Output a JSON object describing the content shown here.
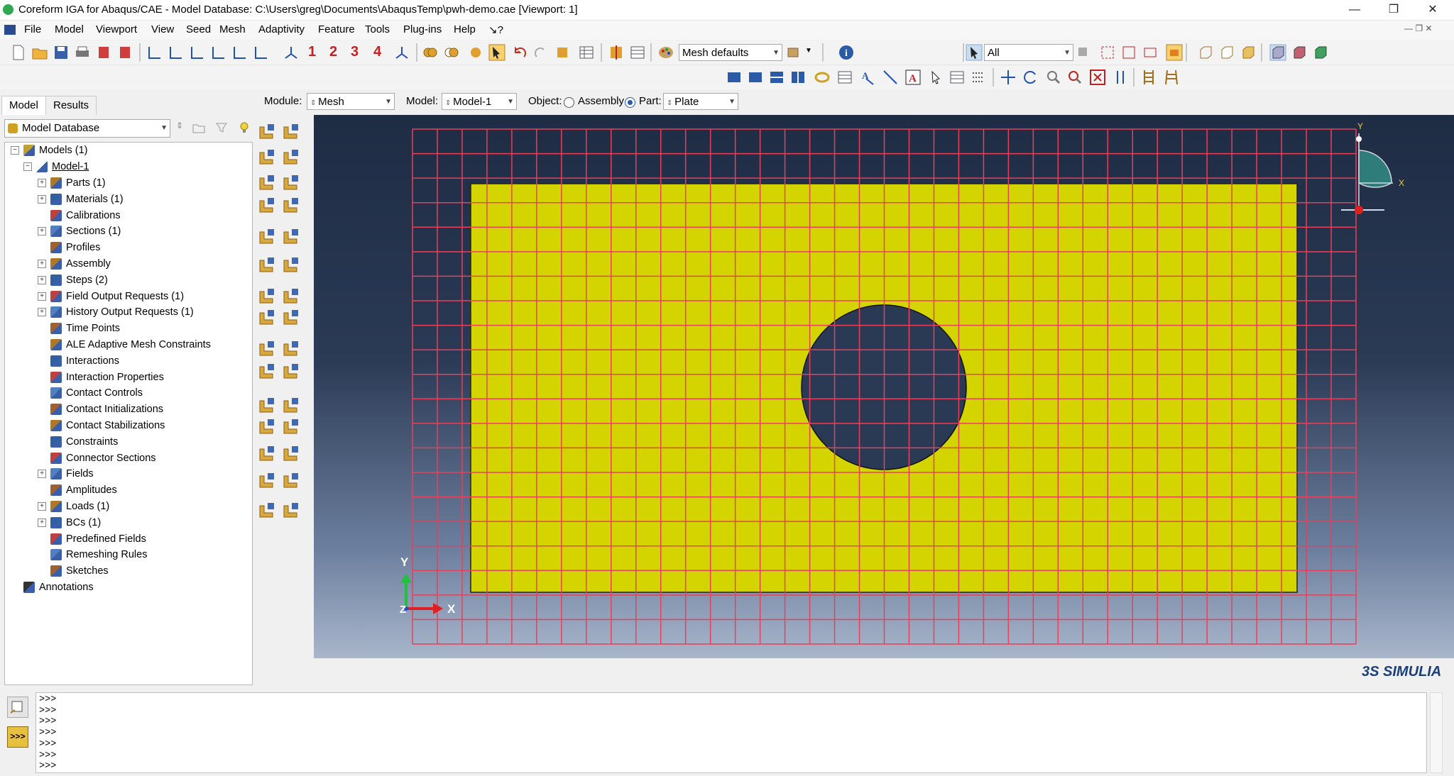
{
  "window": {
    "title": "Coreform IGA for Abaqus/CAE - Model Database: C:\\Users\\greg\\Documents\\AbaqusTemp\\pwh-demo.cae [Viewport: 1]",
    "minimize": "—",
    "restore": "❐",
    "close": "✕"
  },
  "menu": [
    "File",
    "Model",
    "Viewport",
    "View",
    "Seed",
    "Mesh",
    "Adaptivity",
    "Feature",
    "Tools",
    "Plug-ins",
    "Help",
    "↘?"
  ],
  "toolbar": {
    "view_numbers": [
      "1",
      "2",
      "3",
      "4"
    ],
    "color_code_combo": "Mesh defaults",
    "selection_combo": "All"
  },
  "context": {
    "module_label": "Module:",
    "module_value": "Mesh",
    "model_label": "Model:",
    "model_value": "Model-1",
    "object_label": "Object:",
    "assembly_label": "Assembly",
    "part_label": "Part:",
    "part_value": "Plate",
    "selected_object": "Part"
  },
  "tabs": [
    "Model",
    "Results"
  ],
  "active_tab": "Model",
  "model_db_combo": "Model Database",
  "tree": {
    "root": "Models (1)",
    "model": "Model-1",
    "items": [
      {
        "label": "Parts (1)",
        "expandable": true
      },
      {
        "label": "Materials (1)",
        "expandable": true
      },
      {
        "label": "Calibrations",
        "expandable": false
      },
      {
        "label": "Sections (1)",
        "expandable": true
      },
      {
        "label": "Profiles",
        "expandable": false
      },
      {
        "label": "Assembly",
        "expandable": true
      },
      {
        "label": "Steps (2)",
        "expandable": true
      },
      {
        "label": "Field Output Requests (1)",
        "expandable": true
      },
      {
        "label": "History Output Requests (1)",
        "expandable": true
      },
      {
        "label": "Time Points",
        "expandable": false
      },
      {
        "label": "ALE Adaptive Mesh Constraints",
        "expandable": false
      },
      {
        "label": "Interactions",
        "expandable": false
      },
      {
        "label": "Interaction Properties",
        "expandable": false
      },
      {
        "label": "Contact Controls",
        "expandable": false
      },
      {
        "label": "Contact Initializations",
        "expandable": false
      },
      {
        "label": "Contact Stabilizations",
        "expandable": false
      },
      {
        "label": "Constraints",
        "expandable": false
      },
      {
        "label": "Connector Sections",
        "expandable": false
      },
      {
        "label": "Fields",
        "expandable": true
      },
      {
        "label": "Amplitudes",
        "expandable": false
      },
      {
        "label": "Loads (1)",
        "expandable": true
      },
      {
        "label": "BCs (1)",
        "expandable": true
      },
      {
        "label": "Predefined Fields",
        "expandable": false
      },
      {
        "label": "Remeshing Rules",
        "expandable": false
      },
      {
        "label": "Sketches",
        "expandable": false
      }
    ],
    "annotations": "Annotations"
  },
  "viewport": {
    "triad_y": "Y",
    "triad_x": "X",
    "triad_z": "Z",
    "local_y": "Y",
    "local_x": "X",
    "plate_color": "#d4d400",
    "mesh_color": "#e8405a",
    "hole_color": "#2a3a55"
  },
  "brand": "3S SIMULIA",
  "command": {
    "prompts": [
      ">>>",
      ">>>",
      ">>>",
      ">>>",
      ">>>",
      ">>>",
      ">>>"
    ]
  }
}
